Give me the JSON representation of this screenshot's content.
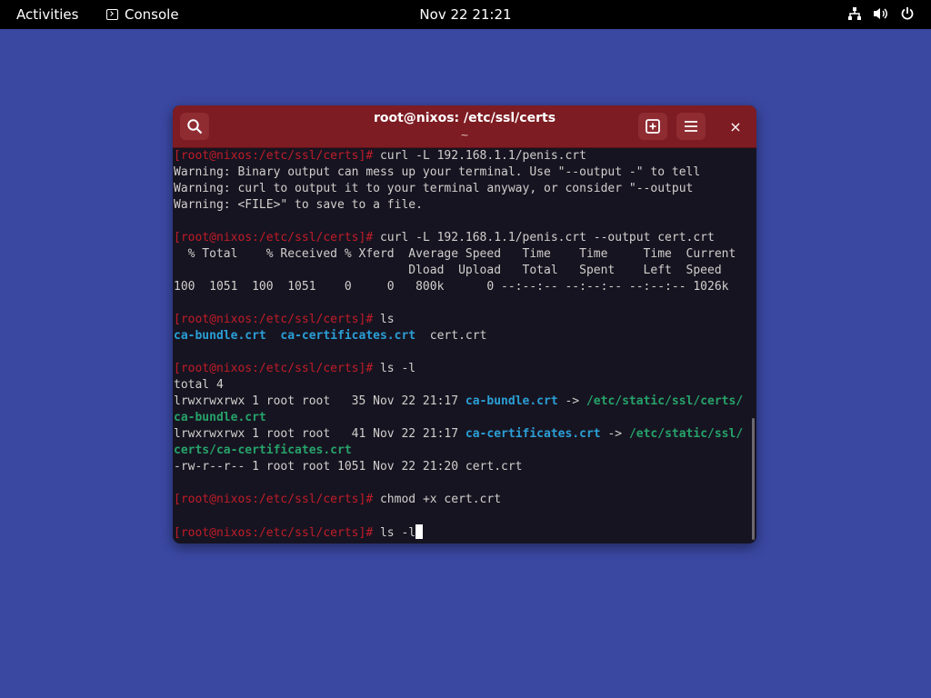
{
  "topbar": {
    "activities": "Activities",
    "app_name": "Console",
    "clock": "Nov 22  21:21",
    "icons": [
      "network-icon",
      "volume-icon",
      "power-icon"
    ]
  },
  "window": {
    "title": "root@nixos: /etc/ssl/certs",
    "subtitle": "~",
    "close_glyph": "×"
  },
  "terminal": {
    "prompt": "[root@nixos:/etc/ssl/certs]#",
    "lines": [
      {
        "prompt": true,
        "cmd": " curl -L 192.168.1.1/penis.crt"
      },
      {
        "text": "Warning: Binary output can mess up your terminal. Use \"--output -\" to tell"
      },
      {
        "text": "Warning: curl to output it to your terminal anyway, or consider \"--output"
      },
      {
        "text": "Warning: <FILE>\" to save to a file."
      },
      {
        "text": ""
      },
      {
        "prompt": true,
        "cmd": " curl -L 192.168.1.1/penis.crt --output cert.crt"
      },
      {
        "text": "  % Total    % Received % Xferd  Average Speed   Time    Time     Time  Current"
      },
      {
        "text": "                                 Dload  Upload   Total   Spent    Left  Speed"
      },
      {
        "text": "100  1051  100  1051    0     0   800k      0 --:--:-- --:--:-- --:--:-- 1026k"
      },
      {
        "text": ""
      },
      {
        "prompt": true,
        "cmd": " ls"
      },
      {
        "segments": [
          {
            "t": "ca-bundle.crt",
            "c": "b"
          },
          {
            "t": "  "
          },
          {
            "t": "ca-certificates.crt",
            "c": "b"
          },
          {
            "t": "  cert.crt"
          }
        ]
      },
      {
        "text": ""
      },
      {
        "prompt": true,
        "cmd": " ls -l"
      },
      {
        "text": "total 4"
      },
      {
        "segments": [
          {
            "t": "lrwxrwxrwx 1 root root   35 Nov 22 21:17 "
          },
          {
            "t": "ca-bundle.crt",
            "c": "b"
          },
          {
            "t": " -> "
          },
          {
            "t": "/etc/static/ssl/certs/",
            "c": "g"
          }
        ]
      },
      {
        "segments": [
          {
            "t": "ca-bundle.crt",
            "c": "g"
          }
        ]
      },
      {
        "segments": [
          {
            "t": "lrwxrwxrwx 1 root root   41 Nov 22 21:17 "
          },
          {
            "t": "ca-certificates.crt",
            "c": "b"
          },
          {
            "t": " -> "
          },
          {
            "t": "/etc/static/ssl/",
            "c": "g"
          }
        ]
      },
      {
        "segments": [
          {
            "t": "certs/ca-certificates.crt",
            "c": "g"
          }
        ]
      },
      {
        "text": "-rw-r--r-- 1 root root 1051 Nov 22 21:20 cert.crt"
      },
      {
        "text": ""
      },
      {
        "prompt": true,
        "cmd": " chmod +x cert.crt"
      },
      {
        "text": ""
      },
      {
        "prompt": true,
        "cmd": " ls -l",
        "cursor": true
      }
    ]
  },
  "colors": {
    "desktop": "#3a48a2",
    "headerbar": "#7d1c22",
    "terminal_bg": "#171421",
    "prompt": "#c01c28",
    "symlink": "#2a9fd6",
    "target": "#26a269"
  }
}
